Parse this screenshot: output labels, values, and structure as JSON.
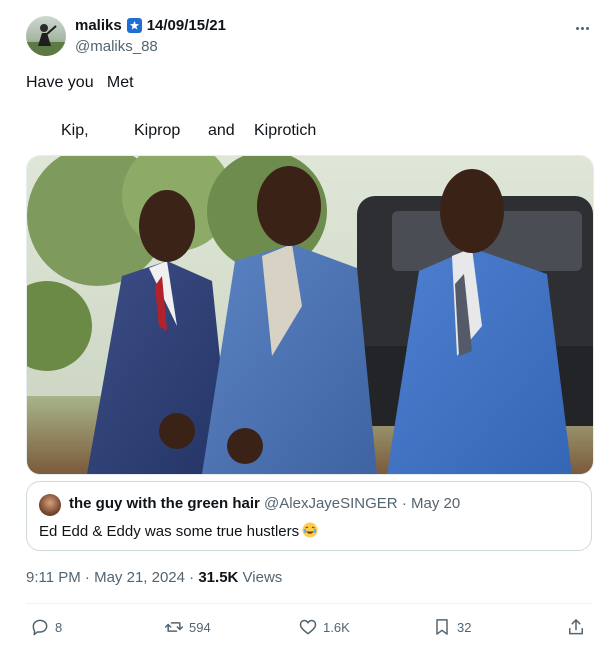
{
  "post": {
    "author_name": "maliks",
    "name_suffix": "14/09/15/21",
    "handle": "@maliks_88",
    "more_icon": "more-icon",
    "badge_icon": "star-badge-icon",
    "text_line1": "Have you   Met",
    "names": [
      "Kip,",
      "Kiprop",
      "and",
      "Kiprotich"
    ]
  },
  "quote": {
    "author_name": "the guy with the green hair",
    "handle": "@AlexJayeSINGER",
    "separator": "·",
    "date": "May 20",
    "text": "Ed Edd & Eddy was some true hustlers",
    "emoji": "laughing-emoji"
  },
  "meta": {
    "time": "9:11 PM",
    "separator": "·",
    "date": "May 21, 2024",
    "separator2": "·",
    "views_count": "31.5K",
    "views_label": "Views"
  },
  "actions": {
    "replies": "8",
    "reposts": "594",
    "likes": "1.6K",
    "bookmarks": "32"
  },
  "colors": {
    "text": "#0f1419",
    "secondary": "#536471",
    "border": "#cfd9de",
    "badge": "#1d6fd6"
  }
}
